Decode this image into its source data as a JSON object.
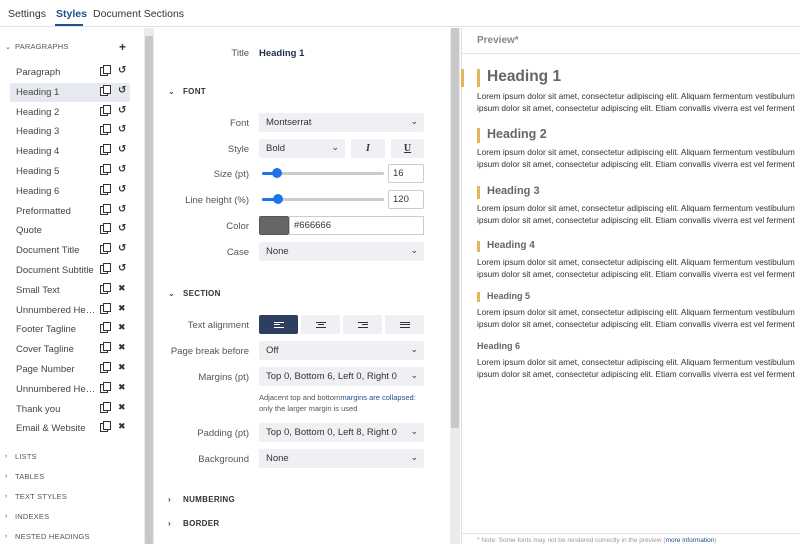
{
  "tabs": [
    "Settings",
    "Styles",
    "Document Sections"
  ],
  "left": {
    "paragraphs_header": "PARAGRAPHS",
    "add_symbol": "+",
    "items": [
      {
        "label": "Paragraph",
        "action": "reset"
      },
      {
        "label": "Heading 1",
        "action": "reset",
        "selected": true
      },
      {
        "label": "Heading 2",
        "action": "reset"
      },
      {
        "label": "Heading 3",
        "action": "reset"
      },
      {
        "label": "Heading 4",
        "action": "reset"
      },
      {
        "label": "Heading 5",
        "action": "reset"
      },
      {
        "label": "Heading 6",
        "action": "reset"
      },
      {
        "label": "Preformatted",
        "action": "reset"
      },
      {
        "label": "Quote",
        "action": "reset"
      },
      {
        "label": "Document Title",
        "action": "reset"
      },
      {
        "label": "Document Subtitle",
        "action": "reset"
      },
      {
        "label": "Small Text",
        "action": "delete"
      },
      {
        "label": "Unnumbered Heading",
        "action": "delete"
      },
      {
        "label": "Footer Tagline",
        "action": "delete"
      },
      {
        "label": "Cover Tagline",
        "action": "delete"
      },
      {
        "label": "Page Number",
        "action": "delete"
      },
      {
        "label": "Unnumbered Heading",
        "action": "delete"
      },
      {
        "label": "Thank you",
        "action": "delete"
      },
      {
        "label": "Email & Website",
        "action": "delete"
      }
    ],
    "collapsed_sections": [
      "LISTS",
      "TABLES",
      "TEXT STYLES",
      "INDEXES",
      "NESTED HEADINGS"
    ]
  },
  "editor": {
    "title_label": "Title",
    "title_value": "Heading 1",
    "font_section": "FONT",
    "font_label": "Font",
    "font_value": "Montserrat",
    "style_label": "Style",
    "style_value": "Bold",
    "italic_btn": "I",
    "underline_btn": "U",
    "size_label": "Size (pt)",
    "size_value": "16",
    "size_fraction": 0.12,
    "lineheight_label": "Line height (%)",
    "lineheight_value": "120",
    "lineheight_fraction": 0.13,
    "color_label": "Color",
    "color_value": "#666666",
    "case_label": "Case",
    "case_value": "None",
    "section_section": "SECTION",
    "align_label": "Text alignment",
    "pagebreak_label": "Page break before",
    "pagebreak_value": "Off",
    "margins_label": "Margins (pt)",
    "margins_value": "Top 0, Bottom 6, Left 0, Right 0",
    "note_pre": "Adjacent top and bottom",
    "note_link": "margins are collapsed",
    "note_post": ": only the larger margin is used",
    "padding_label": "Padding (pt)",
    "padding_value": "Top 0, Bottom 0, Left 8, Right 0",
    "background_label": "Background",
    "background_value": "None",
    "numbering_section": "NUMBERING",
    "border_section": "BORDER"
  },
  "preview": {
    "title": "Preview*",
    "line1": "Lorem ipsum dolor sit amet, consectetur adipiscing elit. Aliquam fermentum vestibulum",
    "line2": "ipsum dolor sit amet, consectetur adipiscing elit. Etiam convallis viverra est vel ferment",
    "headings": [
      "Heading 1",
      "Heading 2",
      "Heading 3",
      "Heading 4",
      "Heading 5",
      "Heading 6"
    ],
    "footer_text": "* Note: Some fonts may not be rendered correctly in the preview (",
    "footer_link": "more information",
    "footer_end": ")"
  },
  "colors": {
    "accent": "#1e4f8f",
    "heading_bar": "#e6b55a",
    "heading_text": "#666666",
    "active_button": "#2d3e60"
  }
}
